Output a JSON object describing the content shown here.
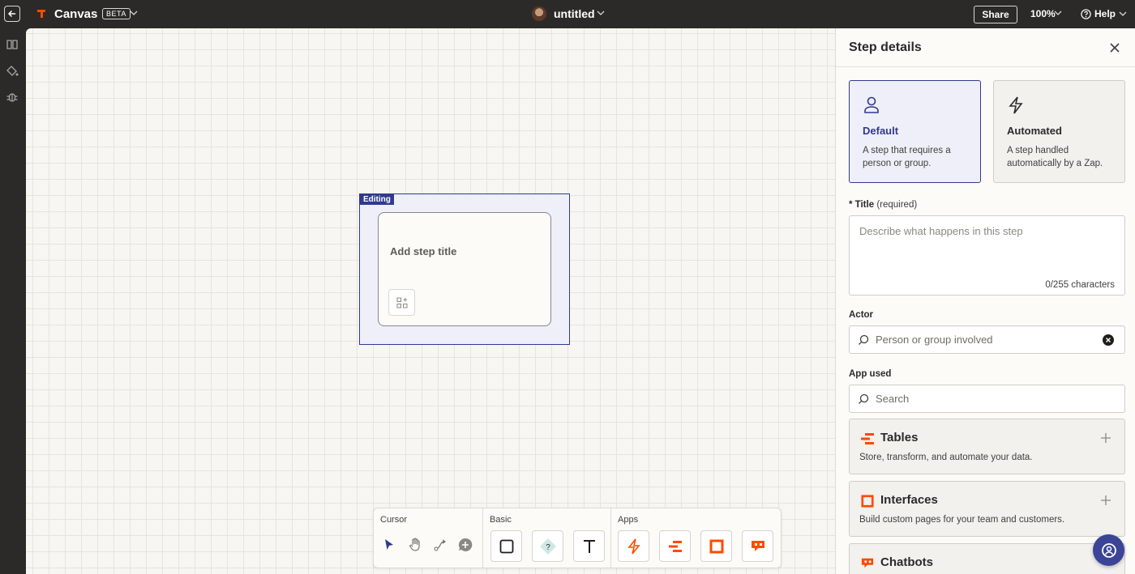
{
  "topbar": {
    "app_name": "Canvas",
    "beta_badge": "BETA",
    "doc_title": "untitled",
    "share_label": "Share",
    "zoom_label": "100%",
    "help_label": "Help"
  },
  "toolbar": {
    "cursor_label": "Cursor",
    "basic_label": "Basic",
    "apps_label": "Apps"
  },
  "canvas": {
    "editing_label": "Editing",
    "step_title_placeholder": "Add step title"
  },
  "panel": {
    "title": "Step details",
    "types": [
      {
        "name": "Default",
        "desc": "A step that requires a person or group."
      },
      {
        "name": "Automated",
        "desc": "A step handled automatically by a Zap."
      }
    ],
    "title_field": {
      "label": "* Title",
      "required": "(required)",
      "placeholder": "Describe what happens in this step",
      "count": "0/255 characters"
    },
    "actor": {
      "label": "Actor",
      "placeholder": "Person or group involved"
    },
    "app_used": {
      "label": "App used",
      "placeholder": "Search"
    },
    "apps": [
      {
        "name": "Tables",
        "desc": "Store, transform, and automate your data."
      },
      {
        "name": "Interfaces",
        "desc": "Build custom pages for your team and customers."
      },
      {
        "name": "Chatbots",
        "desc": ""
      }
    ]
  },
  "colors": {
    "accent": "#2f3a8f",
    "brand_orange": "#ff4a00",
    "topbar": "#2b2a28"
  }
}
